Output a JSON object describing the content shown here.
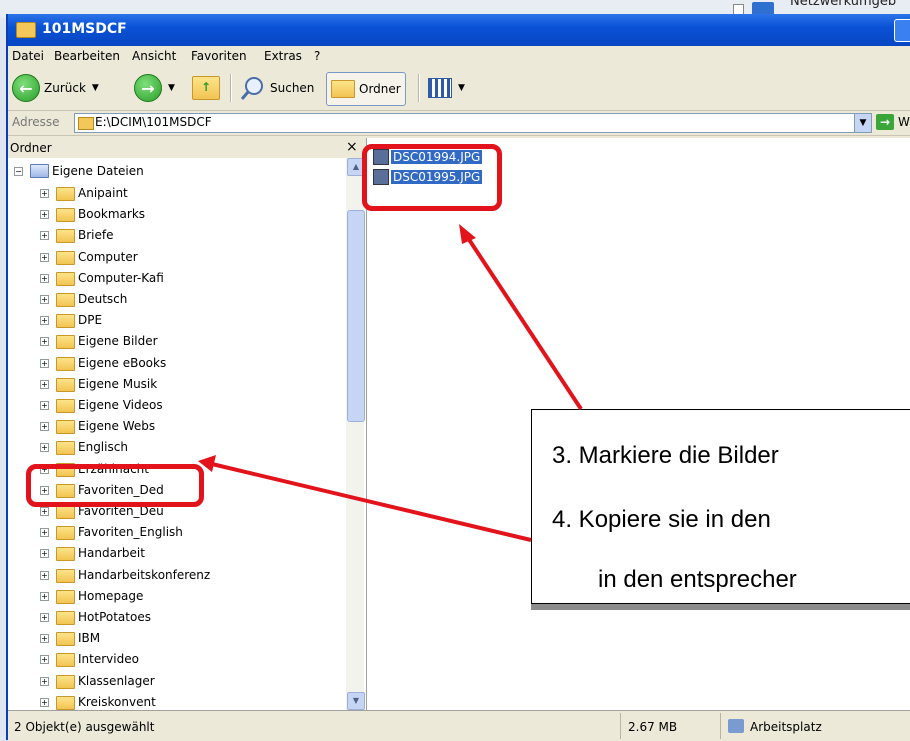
{
  "background_peek": {
    "text": "Netzwerkumgeb"
  },
  "window": {
    "title": "101MSDCF",
    "menu": [
      "Datei",
      "Bearbeiten",
      "Ansicht",
      "Favoriten",
      "Extras",
      "?"
    ],
    "toolbar": {
      "back": "Zurück",
      "search": "Suchen",
      "folders": "Ordner"
    },
    "address": {
      "label": "Adresse",
      "value": "E:\\DCIM\\101MSDCF",
      "go": "W"
    },
    "folder_pane": {
      "title": "Ordner",
      "close": "×",
      "root": "Eigene Dateien",
      "items": [
        "Anipaint",
        "Bookmarks",
        "Briefe",
        "Computer",
        "Computer-Kafi",
        "Deutsch",
        "DPE",
        "Eigene Bilder",
        "Eigene eBooks",
        "Eigene Musik",
        "Eigene Videos",
        "Eigene Webs",
        "Englisch",
        "Erzählnacht",
        "Favoriten_Ded",
        "Favoriten_Deu",
        "Favoriten_English",
        "Handarbeit",
        "Handarbeitskonferenz",
        "Homepage",
        "HotPotatoes",
        "IBM",
        "Intervideo",
        "Klassenlager",
        "Kreiskonvent"
      ]
    },
    "files": [
      "DSC01994.JPG",
      "DSC01995.JPG"
    ],
    "status": {
      "selection": "2 Objekt(e) ausgewählt",
      "size": "2.67 MB",
      "location": "Arbeitsplatz"
    }
  },
  "callout": {
    "line1": "3.  Markiere die Bilder",
    "line2": "4.  Kopiere sie in den",
    "line3": "in den entsprecher"
  },
  "colors": {
    "annotation_red": "#e3131b",
    "selection_blue": "#316ac5",
    "titlebar_blue": "#0a52d6"
  }
}
